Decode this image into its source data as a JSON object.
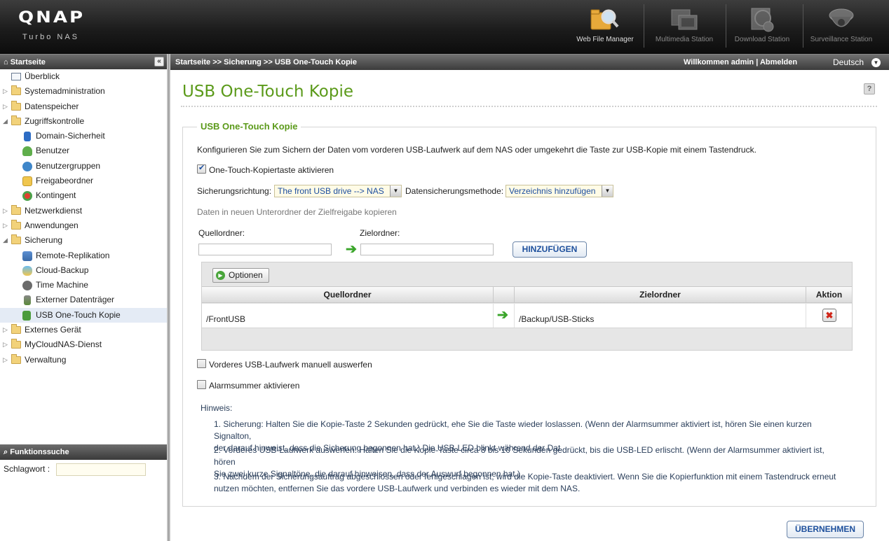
{
  "brand": {
    "logo": "QNAP",
    "subtitle": "Turbo NAS"
  },
  "apps": [
    {
      "label": "Web File Manager",
      "icon": "folder-magnifier-icon",
      "active": true
    },
    {
      "label": "Multimedia Station",
      "icon": "film-photo-icon",
      "active": false
    },
    {
      "label": "Download Station",
      "icon": "globe-download-icon",
      "active": false
    },
    {
      "label": "Surveillance Station",
      "icon": "camera-icon",
      "active": false
    }
  ],
  "sidebar": {
    "header": "Startseite",
    "collapse": "«",
    "items": [
      {
        "label": "Überblick",
        "level": 0,
        "expander": "",
        "icon": "overview-icon"
      },
      {
        "label": "Systemadministration",
        "level": 0,
        "expander": "▷",
        "icon": "folder-icon"
      },
      {
        "label": "Datenspeicher",
        "level": 0,
        "expander": "▷",
        "icon": "folder-icon"
      },
      {
        "label": "Zugriffskontrolle",
        "level": 0,
        "expander": "◢",
        "icon": "folder-icon"
      },
      {
        "label": "Domain-Sicherheit",
        "level": 1,
        "icon": "book-icon"
      },
      {
        "label": "Benutzer",
        "level": 1,
        "icon": "user-icon"
      },
      {
        "label": "Benutzergruppen",
        "level": 1,
        "icon": "user-group-icon"
      },
      {
        "label": "Freigabeordner",
        "level": 1,
        "icon": "shared-folder-icon"
      },
      {
        "label": "Kontingent",
        "level": 1,
        "icon": "quota-icon"
      },
      {
        "label": "Netzwerkdienst",
        "level": 0,
        "expander": "▷",
        "icon": "folder-icon"
      },
      {
        "label": "Anwendungen",
        "level": 0,
        "expander": "▷",
        "icon": "folder-icon"
      },
      {
        "label": "Sicherung",
        "level": 0,
        "expander": "◢",
        "icon": "folder-icon"
      },
      {
        "label": "Remote-Replikation",
        "level": 1,
        "icon": "replication-icon"
      },
      {
        "label": "Cloud-Backup",
        "level": 1,
        "icon": "cloud-icon"
      },
      {
        "label": "Time Machine",
        "level": 1,
        "icon": "apple-icon"
      },
      {
        "label": "Externer Datenträger",
        "level": 1,
        "icon": "external-drive-icon"
      },
      {
        "label": "USB One-Touch Kopie",
        "level": 1,
        "icon": "usb-icon",
        "selected": true
      },
      {
        "label": "Externes Gerät",
        "level": 0,
        "expander": "▷",
        "icon": "folder-icon"
      },
      {
        "label": "MyCloudNAS-Dienst",
        "level": 0,
        "expander": "▷",
        "icon": "folder-icon"
      },
      {
        "label": "Verwaltung",
        "level": 0,
        "expander": "▷",
        "icon": "folder-icon"
      }
    ]
  },
  "search": {
    "header": "Funktionssuche",
    "label": "Schlagwort :",
    "value": ""
  },
  "crumbbar": {
    "breadcrumb": "Startseite >> Sicherung >> USB One-Touch Kopie",
    "welcome": "Willkommen admin",
    "separator": "|",
    "logout": "Abmelden",
    "language": "Deutsch"
  },
  "page": {
    "title": "USB One-Touch Kopie",
    "help": "?",
    "section_title": "USB One-Touch Kopie",
    "description": "Konfigurieren Sie zum Sichern der Daten vom vorderen USB-Laufwerk auf dem NAS oder umgekehrt die Taste zur USB-Kopie mit einem Tastendruck.",
    "enable_label": "One-Touch-Kopiertaste aktivieren",
    "enable_checked": true,
    "direction_label": "Sicherungsrichtung:",
    "direction_value": "The front USB drive --> NAS",
    "method_label": "Datensicherungsmethode:",
    "method_value": "Verzeichnis hinzufügen",
    "subfolder_label": "Daten in neuen Unterordner der Zielfreigabe kopieren",
    "source_label": "Quellordner:",
    "source_value": "",
    "target_label": "Zielordner:",
    "target_value": "",
    "add_button": "HINZUFÜGEN",
    "options_button": "Optionen",
    "table": {
      "headers": [
        "Quellordner",
        "",
        "Zielordner",
        "Aktion"
      ],
      "rows": [
        {
          "source": "/FrontUSB",
          "target": "/Backup/USB-Sticks"
        }
      ]
    },
    "eject_label": "Vorderes USB-Laufwerk manuell auswerfen",
    "eject_checked": false,
    "buzzer_label": "Alarmsummer aktivieren",
    "buzzer_checked": false,
    "notes_title": "Hinweis:",
    "notes": [
      [
        "1. Sicherung: Halten Sie die Kopie-Taste 2 Sekunden gedrückt, ehe Sie die Taste wieder loslassen. (Wenn der Alarmsummer aktiviert ist, hören Sie einen kurzen Signalton,",
        "der darauf hinweist, dass die Sicherung begonnen hat.) Die USB-LED blinkt während der Dat"
      ],
      [
        "2. Vorderes USB-Laufwerk auswerfen: Halten Sie die Kopie-Taste circa 8 bis 10 Sekunden gedrückt, bis die USB-LED erlischt. (Wenn der Alarmsummer aktiviert ist, hören",
        "Sie zwei kurze Signaltöne, die darauf hinweisen, dass der Auswurf begonnen hat.)"
      ],
      [
        "3. Nachdem der Sicherungsauftrag abgeschlossen oder fehlgeschlagen ist, wird die Kopie-Taste deaktiviert. Wenn Sie die Kopierfunktion mit einem Tastendruck erneut",
        "nutzen möchten, entfernen Sie das vordere USB-Laufwerk und verbinden es wieder mit dem NAS."
      ]
    ],
    "apply_button": "ÜBERNEHMEN"
  },
  "colors": {
    "accent_green": "#5b9a1a",
    "link_blue": "#1d4f9c",
    "header_dark": "#3a3a3a"
  }
}
